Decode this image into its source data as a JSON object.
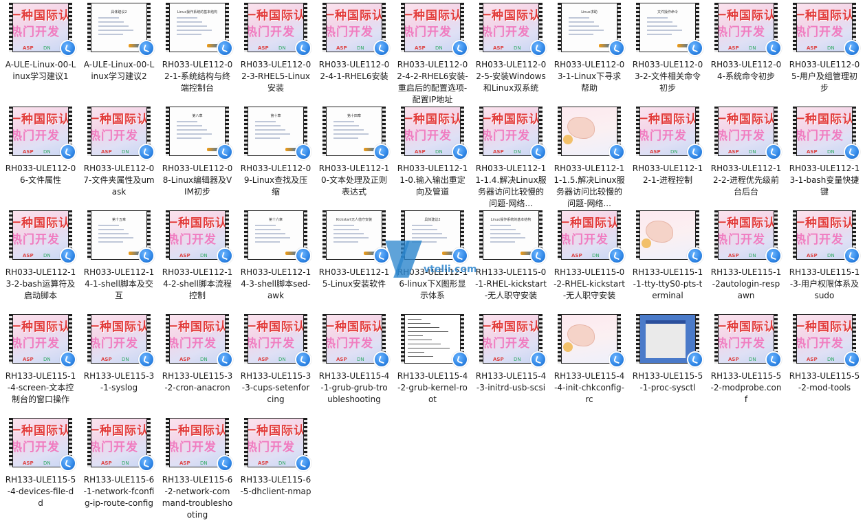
{
  "window": {
    "view": "large-icons",
    "badge_icon": "shortcut-arrow-icon"
  },
  "watermark": {
    "text": "vtelli.com",
    "color": "#2a84cc"
  },
  "promo_thumb": {
    "line1": "一种国际认",
    "line2": "热门开发",
    "line3": "ASP",
    "line4": "DN"
  },
  "slide_titles": {
    "t1": "具体建议2",
    "t2": "Linux操作系统的基本结构",
    "t3": "Linux求助",
    "t4": "文件操作命令",
    "t5": "第八章",
    "t6": "第十章",
    "t7": "第十四章",
    "t8": "第十五章",
    "t9": "第十六章",
    "t10": "Kickstart无人值守安装"
  },
  "files": [
    {
      "name": "A-ULE-Linux-00-Linux学习建议1",
      "thumb": "promo"
    },
    {
      "name": "A-ULE-Linux-00-Linux学习建议2",
      "thumb": "slide"
    },
    {
      "name": "RH033-ULE112-02-1-系统结构与终端控制台",
      "thumb": "slide"
    },
    {
      "name": "RH033-ULE112-02-3-RHEL5-Linux安装",
      "thumb": "promo"
    },
    {
      "name": "RH033-ULE112-02-4-1-RHEL6安装",
      "thumb": "promo"
    },
    {
      "name": "RH033-ULE112-02-4-2-RHEL6安装-重启后的配置选项-配置IP地址",
      "thumb": "promo"
    },
    {
      "name": "RH033-ULE112-02-5-安装Windows和Linux双系统",
      "thumb": "promo"
    },
    {
      "name": "RH033-ULE112-03-1-Linux下寻求帮助",
      "thumb": "slide"
    },
    {
      "name": "RH033-ULE112-03-2-文件相关命令初步",
      "thumb": "slide"
    },
    {
      "name": "RH033-ULE112-04-系统命令初步",
      "thumb": "promo"
    },
    {
      "name": "RH033-ULE112-05-用户及组管理初步",
      "thumb": "promo"
    },
    {
      "name": "RH033-ULE112-06-文件属性",
      "thumb": "promo"
    },
    {
      "name": "RH033-ULE112-07-文件夹属性及umask",
      "thumb": "promo"
    },
    {
      "name": "RH033-ULE112-08-Linux编辑器及VIM初步",
      "thumb": "slide"
    },
    {
      "name": "RH033-ULE112-09-Linux查找及压缩",
      "thumb": "slide"
    },
    {
      "name": "RH033-ULE112-10-文本处理及正则表达式",
      "thumb": "slide"
    },
    {
      "name": "RH033-ULE112-11-0.输入输出重定向及管道",
      "thumb": "promo"
    },
    {
      "name": "RH033-ULE112-11-1.4.解决Linux服务器访问比较慢的问题-网络...",
      "thumb": "promo"
    },
    {
      "name": "RH033-ULE112-11-1.5.解决Linux服务器访问比较慢的问题-网络...",
      "thumb": "map"
    },
    {
      "name": "RH033-ULE112-12-1-进程控制",
      "thumb": "promo"
    },
    {
      "name": "RH033-ULE112-12-2-进程优先级前台后台",
      "thumb": "promo"
    },
    {
      "name": "RH033-ULE112-13-1-bash变量快捷键",
      "thumb": "promo"
    },
    {
      "name": "RH033-ULE112-13-2-bash运算符及启动脚本",
      "thumb": "promo"
    },
    {
      "name": "RH033-ULE112-14-1-shell脚本及交互",
      "thumb": "slide"
    },
    {
      "name": "RH033-ULE112-14-2-shell脚本流程控制",
      "thumb": "promo"
    },
    {
      "name": "RH033-ULE112-14-3-shell脚本sed-awk",
      "thumb": "slide"
    },
    {
      "name": "RH033-ULE112-15-Linux安装软件",
      "thumb": "slide"
    },
    {
      "name": "RH033-ULE112-16-linux下X图形显示体系",
      "thumb": "slide"
    },
    {
      "name": "RH133-ULE115-0-1-RHEL-kickstart-无人职守安装",
      "thumb": "slide"
    },
    {
      "name": "RH133-ULE115-0-2-RHEL-kickstart-无人职守安装",
      "thumb": "promo"
    },
    {
      "name": "RH133-ULE115-1-1-tty-ttyS0-pts-terminal",
      "thumb": "map"
    },
    {
      "name": "RH133-ULE115-1-2autologin-respawn",
      "thumb": "promo"
    },
    {
      "name": "RH133-ULE115-1-3-用户权限体系及sudo",
      "thumb": "promo"
    },
    {
      "name": "RH133-ULE115-1-4-screen-文本控制台的窗口操作",
      "thumb": "promo"
    },
    {
      "name": "RH133-ULE115-3-1-syslog",
      "thumb": "promo"
    },
    {
      "name": "RH133-ULE115-3-2-cron-anacron",
      "thumb": "promo"
    },
    {
      "name": "RH133-ULE115-3-3-cups-setenforcing",
      "thumb": "promo"
    },
    {
      "name": "RH133-ULE115-4-1-grub-grub-troubleshooting",
      "thumb": "promo"
    },
    {
      "name": "RH133-ULE115-4-2-grub-kernel-root",
      "thumb": "term"
    },
    {
      "name": "RH133-ULE115-4-3-initrd-usb-scsi",
      "thumb": "promo"
    },
    {
      "name": "RH133-ULE115-4-4-init-chkconfig-rc",
      "thumb": "map"
    },
    {
      "name": "RH133-ULE115-5-1-proc-sysctl",
      "thumb": "desk"
    },
    {
      "name": "RH133-ULE115-5-2-modprobe.conf",
      "thumb": "promo"
    },
    {
      "name": "RH133-ULE115-5-2-mod-tools",
      "thumb": "promo"
    },
    {
      "name": "RH133-ULE115-5-4-devices-file-dd",
      "thumb": "promo"
    },
    {
      "name": "RH133-ULE115-6-1-network-fconfig-ip-route-config",
      "thumb": "promo"
    },
    {
      "name": "RH133-ULE115-6-2-network-command-troubleshooting",
      "thumb": "promo"
    },
    {
      "name": "RH133-ULE115-6-5-dhclient-nmap",
      "thumb": "promo"
    }
  ]
}
